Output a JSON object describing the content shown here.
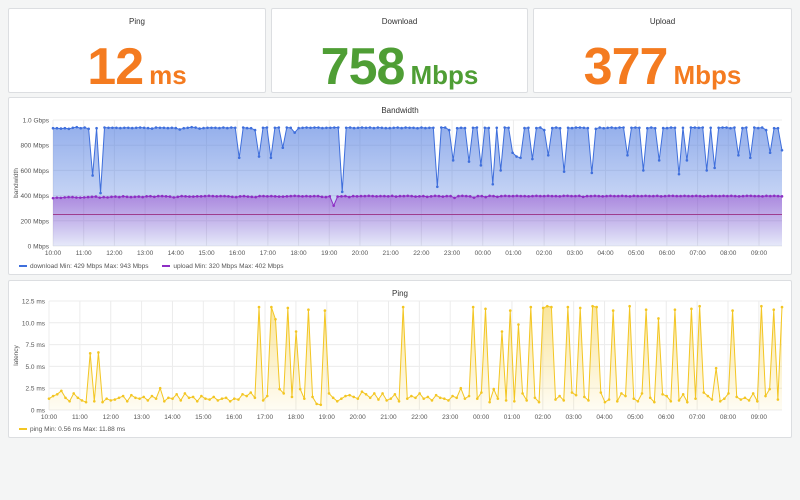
{
  "stats": [
    {
      "id": "ping",
      "title": "Ping",
      "value": "12",
      "unit": "ms",
      "color": "#f47b20"
    },
    {
      "id": "download",
      "title": "Download",
      "value": "758",
      "unit": "Mbps",
      "color": "#4f9e35"
    },
    {
      "id": "upload",
      "title": "Upload",
      "value": "377",
      "unit": "Mbps",
      "color": "#f47b20"
    }
  ],
  "colors": {
    "download": "#3f6fdc",
    "upload": "#8e2fc4",
    "ping": "#f3c623",
    "threshold": "#c4365c"
  },
  "bandwidth_panel": {
    "title": "Bandwidth",
    "legend": [
      {
        "name": "download",
        "text": "download  Min: 429 Mbps  Max: 943 Mbps"
      },
      {
        "name": "upload",
        "text": "upload  Min: 320 Mbps  Max: 402 Mbps"
      }
    ]
  },
  "ping_panel": {
    "title": "Ping",
    "legend": [
      {
        "name": "ping",
        "text": "ping  Min: 0.56 ms  Max: 11.88 ms"
      }
    ]
  },
  "chart_data": [
    {
      "type": "line",
      "title": "Bandwidth",
      "ylabel": "bandwidth",
      "ylim": [
        0,
        1000
      ],
      "y_ticks": [
        "0 Mbps",
        "200 Mbps",
        "400 Mbps",
        "600 Mbps",
        "800 Mbps",
        "1.0 Gbps"
      ],
      "x_ticks": [
        "10:00",
        "11:00",
        "12:00",
        "13:00",
        "14:00",
        "15:00",
        "16:00",
        "17:00",
        "18:00",
        "19:00",
        "20:00",
        "21:00",
        "22:00",
        "23:00",
        "00:00",
        "01:00",
        "02:00",
        "03:00",
        "04:00",
        "05:00",
        "06:00",
        "07:00",
        "08:00",
        "09:00"
      ],
      "threshold": 250,
      "grid": true,
      "legend_position": "bottom-left",
      "series": [
        {
          "name": "download",
          "values": [
            935,
            935,
            932,
            935,
            930,
            938,
            943,
            935,
            940,
            930,
            560,
            935,
            420,
            940,
            938,
            938,
            938,
            936,
            938,
            938,
            936,
            938,
            940,
            938,
            936,
            932,
            940,
            938,
            938,
            936,
            938,
            936,
            925,
            935,
            938,
            943,
            940,
            932,
            936,
            938,
            938,
            938,
            936,
            940,
            936,
            940,
            938,
            700,
            940,
            936,
            935,
            920,
            710,
            938,
            940,
            700,
            938,
            940,
            780,
            940,
            938,
            900,
            936,
            938,
            940,
            938,
            940,
            940,
            936,
            938,
            938,
            940,
            940,
            430,
            938,
            940,
            936,
            938,
            940,
            938,
            940,
            936,
            940,
            938,
            936,
            936,
            938,
            940,
            936,
            940,
            938,
            938,
            935,
            940,
            936,
            938,
            938,
            470,
            940,
            940,
            920,
            680,
            935,
            938,
            936,
            670,
            938,
            940,
            640,
            938,
            937,
            490,
            938,
            600,
            940,
            938,
            740,
            710,
            700,
            936,
            938,
            690,
            936,
            940,
            920,
            720,
            936,
            940,
            935,
            590,
            938,
            936,
            940,
            940,
            938,
            936,
            580,
            930,
            940,
            935,
            938,
            940,
            936,
            940,
            940,
            720,
            938,
            940,
            938,
            600,
            935,
            940,
            935,
            680,
            936,
            936,
            940,
            938,
            570,
            938,
            680,
            940,
            940,
            938,
            940,
            600,
            938,
            620,
            938,
            940,
            940,
            935,
            940,
            720,
            936,
            940,
            700,
            940,
            936,
            940,
            920,
            740,
            935,
            935,
            760
          ]
        },
        {
          "name": "upload",
          "values": [
            380,
            384,
            382,
            386,
            388,
            388,
            385,
            384,
            386,
            388,
            390,
            392,
            384,
            388,
            386,
            390,
            392,
            388,
            394,
            390,
            388,
            390,
            392,
            388,
            394,
            395,
            390,
            396,
            396,
            394,
            392,
            386,
            390,
            396,
            394,
            392,
            392,
            394,
            394,
            396,
            398,
            396,
            394,
            396,
            396,
            394,
            390,
            388,
            394,
            396,
            392,
            390,
            388,
            396,
            396,
            394,
            396,
            394,
            392,
            392,
            394,
            396,
            398,
            396,
            394,
            396,
            394,
            396,
            396,
            390,
            388,
            394,
            320,
            392,
            394,
            396,
            388,
            396,
            394,
            396,
            396,
            398,
            396,
            394,
            396,
            396,
            394,
            398,
            392,
            396,
            396,
            398,
            396,
            392,
            394,
            396,
            390,
            394,
            398,
            396,
            392,
            396,
            396,
            382,
            396,
            398,
            396,
            394,
            384,
            396,
            396,
            388,
            398,
            396,
            390,
            396,
            398,
            396,
            396,
            398,
            396,
            396,
            394,
            396,
            398,
            396,
            396,
            398,
            396,
            396,
            394,
            398,
            398,
            396,
            396,
            398,
            390,
            396,
            396,
            398,
            396,
            394,
            396,
            398,
            396,
            396,
            398,
            396,
            394,
            398,
            396,
            396,
            398,
            396,
            396,
            398,
            394,
            396,
            398,
            398,
            396,
            396,
            398,
            396,
            396,
            398,
            396,
            394,
            396,
            398,
            396,
            396,
            398,
            396,
            398,
            396,
            394,
            396,
            398,
            398,
            396,
            396,
            394,
            398,
            396,
            398,
            396,
            394
          ]
        }
      ]
    },
    {
      "type": "area",
      "title": "Ping",
      "ylabel": "latency",
      "ylim": [
        0,
        12.5
      ],
      "y_ticks": [
        "0 ms",
        "2.5 ms",
        "5.0 ms",
        "7.5 ms",
        "10.0 ms",
        "12.5 ms"
      ],
      "x_ticks": [
        "10:00",
        "11:00",
        "12:00",
        "13:00",
        "14:00",
        "15:00",
        "16:00",
        "17:00",
        "18:00",
        "19:00",
        "20:00",
        "21:00",
        "22:00",
        "23:00",
        "00:00",
        "01:00",
        "02:00",
        "03:00",
        "04:00",
        "05:00",
        "06:00",
        "07:00",
        "08:00",
        "09:00"
      ],
      "grid": true,
      "legend_position": "bottom-left",
      "series": [
        {
          "name": "ping",
          "values": [
            1.3,
            1.6,
            1.8,
            2.2,
            1.4,
            1.0,
            1.9,
            1.4,
            1.1,
            0.9,
            6.5,
            1.0,
            6.6,
            0.9,
            1.3,
            1.1,
            1.2,
            1.4,
            1.6,
            1.0,
            1.7,
            1.4,
            1.3,
            1.5,
            1.1,
            1.6,
            1.3,
            2.5,
            1.0,
            1.4,
            1.3,
            1.8,
            1.1,
            1.9,
            1.4,
            1.5,
            1.0,
            1.6,
            1.3,
            1.2,
            1.5,
            1.1,
            1.3,
            1.4,
            1.0,
            1.3,
            1.2,
            1.8,
            1.6,
            2.0,
            1.4,
            11.8,
            1.1,
            1.6,
            11.8,
            10.4,
            2.4,
            1.9,
            11.7,
            1.5,
            9.0,
            2.4,
            1.3,
            11.5,
            1.5,
            0.7,
            0.6,
            11.4,
            1.9,
            1.4,
            1.0,
            1.3,
            1.6,
            1.7,
            1.5,
            1.3,
            2.1,
            1.8,
            1.4,
            1.9,
            1.2,
            1.9,
            1.1,
            1.3,
            1.8,
            1.0,
            11.8,
            1.3,
            1.6,
            1.4,
            1.9,
            1.3,
            1.5,
            1.1,
            1.7,
            1.4,
            1.3,
            1.1,
            1.6,
            1.4,
            2.5,
            1.3,
            1.6,
            11.8,
            1.3,
            2.0,
            11.6,
            0.9,
            2.4,
            1.3,
            9.0,
            1.1,
            11.4,
            1.0,
            9.8,
            1.9,
            1.1,
            11.8,
            1.4,
            0.9,
            11.7,
            11.9,
            11.8,
            1.2,
            1.6,
            1.1,
            11.8,
            2.0,
            1.7,
            11.7,
            1.5,
            1.1,
            11.9,
            11.8,
            2.0,
            0.9,
            1.2,
            11.4,
            1.0,
            1.9,
            1.6,
            11.9,
            1.3,
            1.0,
            1.9,
            11.5,
            1.4,
            0.9,
            10.5,
            1.8,
            1.6,
            1.0,
            11.5,
            1.1,
            1.8,
            0.9,
            11.6,
            1.3,
            11.9,
            2.0,
            1.6,
            1.2,
            4.8,
            1.0,
            1.3,
            1.9,
            11.4,
            1.5,
            1.2,
            1.4,
            1.1,
            1.9,
            1.0,
            11.9,
            1.6,
            2.4,
            11.5,
            1.2,
            11.8
          ]
        }
      ]
    }
  ]
}
